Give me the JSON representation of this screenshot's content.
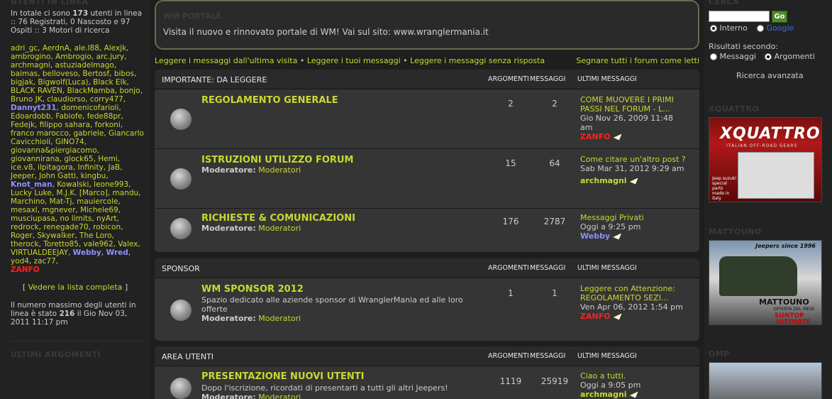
{
  "left": {
    "online_header": "UTENTI IN LINEA",
    "stats_prefix": "In totale ci sono",
    "stats_total": "173",
    "stats_rest": "utenti in linea :: 76 Registrati, 0 Nascosto e 97 Ospiti :: 3 Motori di ricerca",
    "users_line1": "adri_gc, AerdnA, ale.l88, Alexjk, ambrogino, Ambrogio, arc.jury, archmagni, astuziadelmago, baimas, belloveso, Bertosf, bibos, bigjak, Bigwolf(Luca), Black Elk, BLACK RAVEN, BlackMamba, bonjo, Bruno JK, claudiorso, corry477,",
    "user_dannyt": "Dannyt231",
    "users_line2": ", domenicofarioli, Edoardobb, Fabiofe, fede88pr, Fedejk, filippo sahara, forkoni, franco marocco, gabriele, Giancarlo Cavicchioli, GINO74, giovanna&piergiacomo, giovannirana, glock65, Hemi, ice.v8, ilpitagora, Infinity, JaB, Jeeper, John Gatti, kingbu,",
    "user_knot": "Knot_man",
    "users_line3": ", Kowalski, leone993, Lucky Luke, M.J.K. [Marco], mandu, Marchino, Mat-Tj, mauiercole, mesaxl, mgnever, Michele69, musciupasa, no limits, nyArt, redrock, renegade70, robicon, Roger, Skywalker, The Loro, therock, Toretto85, vale962, Valex, VIRTUALDEEJAY,",
    "user_webby": "Webby",
    "user_wred": "Wred",
    "users_line4": ", yod4, zac77,",
    "user_zanfo": "ZANFO",
    "full_list_link": "Vedere la lista completa",
    "max_prefix": "Il numero massimo degli utenti in linea è stato",
    "max_count": "216",
    "max_suffix": "il Gio Nov 03, 2011 11:17 pm",
    "latest_header": "ULTIMI ARGOMENTI"
  },
  "portal": {
    "title": "WM PORTALE",
    "message": "Visita il nuovo e rinnovato portale di WM! Vai sul sito: www.wranglermania.it"
  },
  "nav": {
    "link1": "Leggere i messaggi dall'ultima visita",
    "link2": "Leggere i tuoi messaggi",
    "link3": "Leggere i messaggi senza risposta",
    "link_right": "Segnare tutti i forum come letti"
  },
  "columns": {
    "topics": "ARGOMENTI",
    "posts": "MESSAGGI",
    "last": "ULTIMI MESSAGGI"
  },
  "categories": [
    {
      "name": "IMPORTANTE: DA LEGGERE",
      "forums": [
        {
          "name": "REGOLAMENTO GENERALE",
          "topics": "2",
          "posts": "2",
          "last_title": "COME MUOVERE I PRIMI PASSI NEL FORUM - L...",
          "last_date": "Gio Nov 26, 2009 11:48 am",
          "last_author": "ZANFO"
        },
        {
          "name": "ISTRUZIONI UTILIZZO FORUM",
          "mod_label": "Moderatore:",
          "mod": "Moderatori",
          "topics": "15",
          "posts": "64",
          "last_title": "Come citare un'altro post ?",
          "last_date": "Sab Mar 31, 2012 9:29 am",
          "last_author": "archmagni"
        },
        {
          "name": "RICHIESTE & COMUNICAZIONI",
          "mod_label": "Moderatore:",
          "mod": "Moderatori",
          "topics": "176",
          "posts": "2787",
          "last_title": "Messaggi Privati",
          "last_date": "Oggi a 9:25 pm",
          "last_author": "Webby"
        }
      ]
    },
    {
      "name": "SPONSOR",
      "forums": [
        {
          "name": "WM SPONSOR 2012",
          "desc": "Spazio dedicato alle aziende sponsor di WranglerMania ed alle loro offerte",
          "mod_label": "Moderatore:",
          "mod": "Moderatori",
          "topics": "1",
          "posts": "1",
          "last_title": "Leggere con Attenzione: REGOLAMENTO SEZI...",
          "last_date": "Ven Apr 06, 2012 1:54 pm",
          "last_author": "ZANFO"
        }
      ]
    },
    {
      "name": "AREA UTENTI",
      "forums": [
        {
          "name": "PRESENTAZIONE NUOVI UTENTI",
          "desc": "Dopo l'iscrizione, ricordati di presentarti a tutti gli altri Jeepers!",
          "mod_label": "Moderatore:",
          "mod": "Moderatori",
          "topics": "1119",
          "posts": "25919",
          "last_title": "Ciao a tutti.",
          "last_date": "Oggi a 9:05 pm",
          "last_author": "archmagni"
        }
      ]
    }
  ],
  "right": {
    "search_header": "CERCA",
    "go_label": "Go",
    "opt_internal": "Interno",
    "opt_google": "Google",
    "results_label": "Risultati secondo:",
    "opt_messages": "Messaggi",
    "opt_topics": "Argomenti",
    "advanced": "Ricerca avanzata",
    "ad1_header": "XQUATTRO",
    "ad1_logo": "XQUATTRO",
    "ad1_sub": "ITALIAN OFF-ROAD GEARS",
    "ad1_side": "Jeep suzuki special parts made in italy",
    "ad2_header": "MATTOUNO",
    "ad2_since": "Jeepers since 1996",
    "ad2_brand": "MATTOUNO",
    "ad2_offer": "OFFERTA DEL MESE",
    "ad2_product1": "SUNTOP",
    "ad2_product2": "ULTIMATE",
    "ad3_header": "OMP"
  }
}
